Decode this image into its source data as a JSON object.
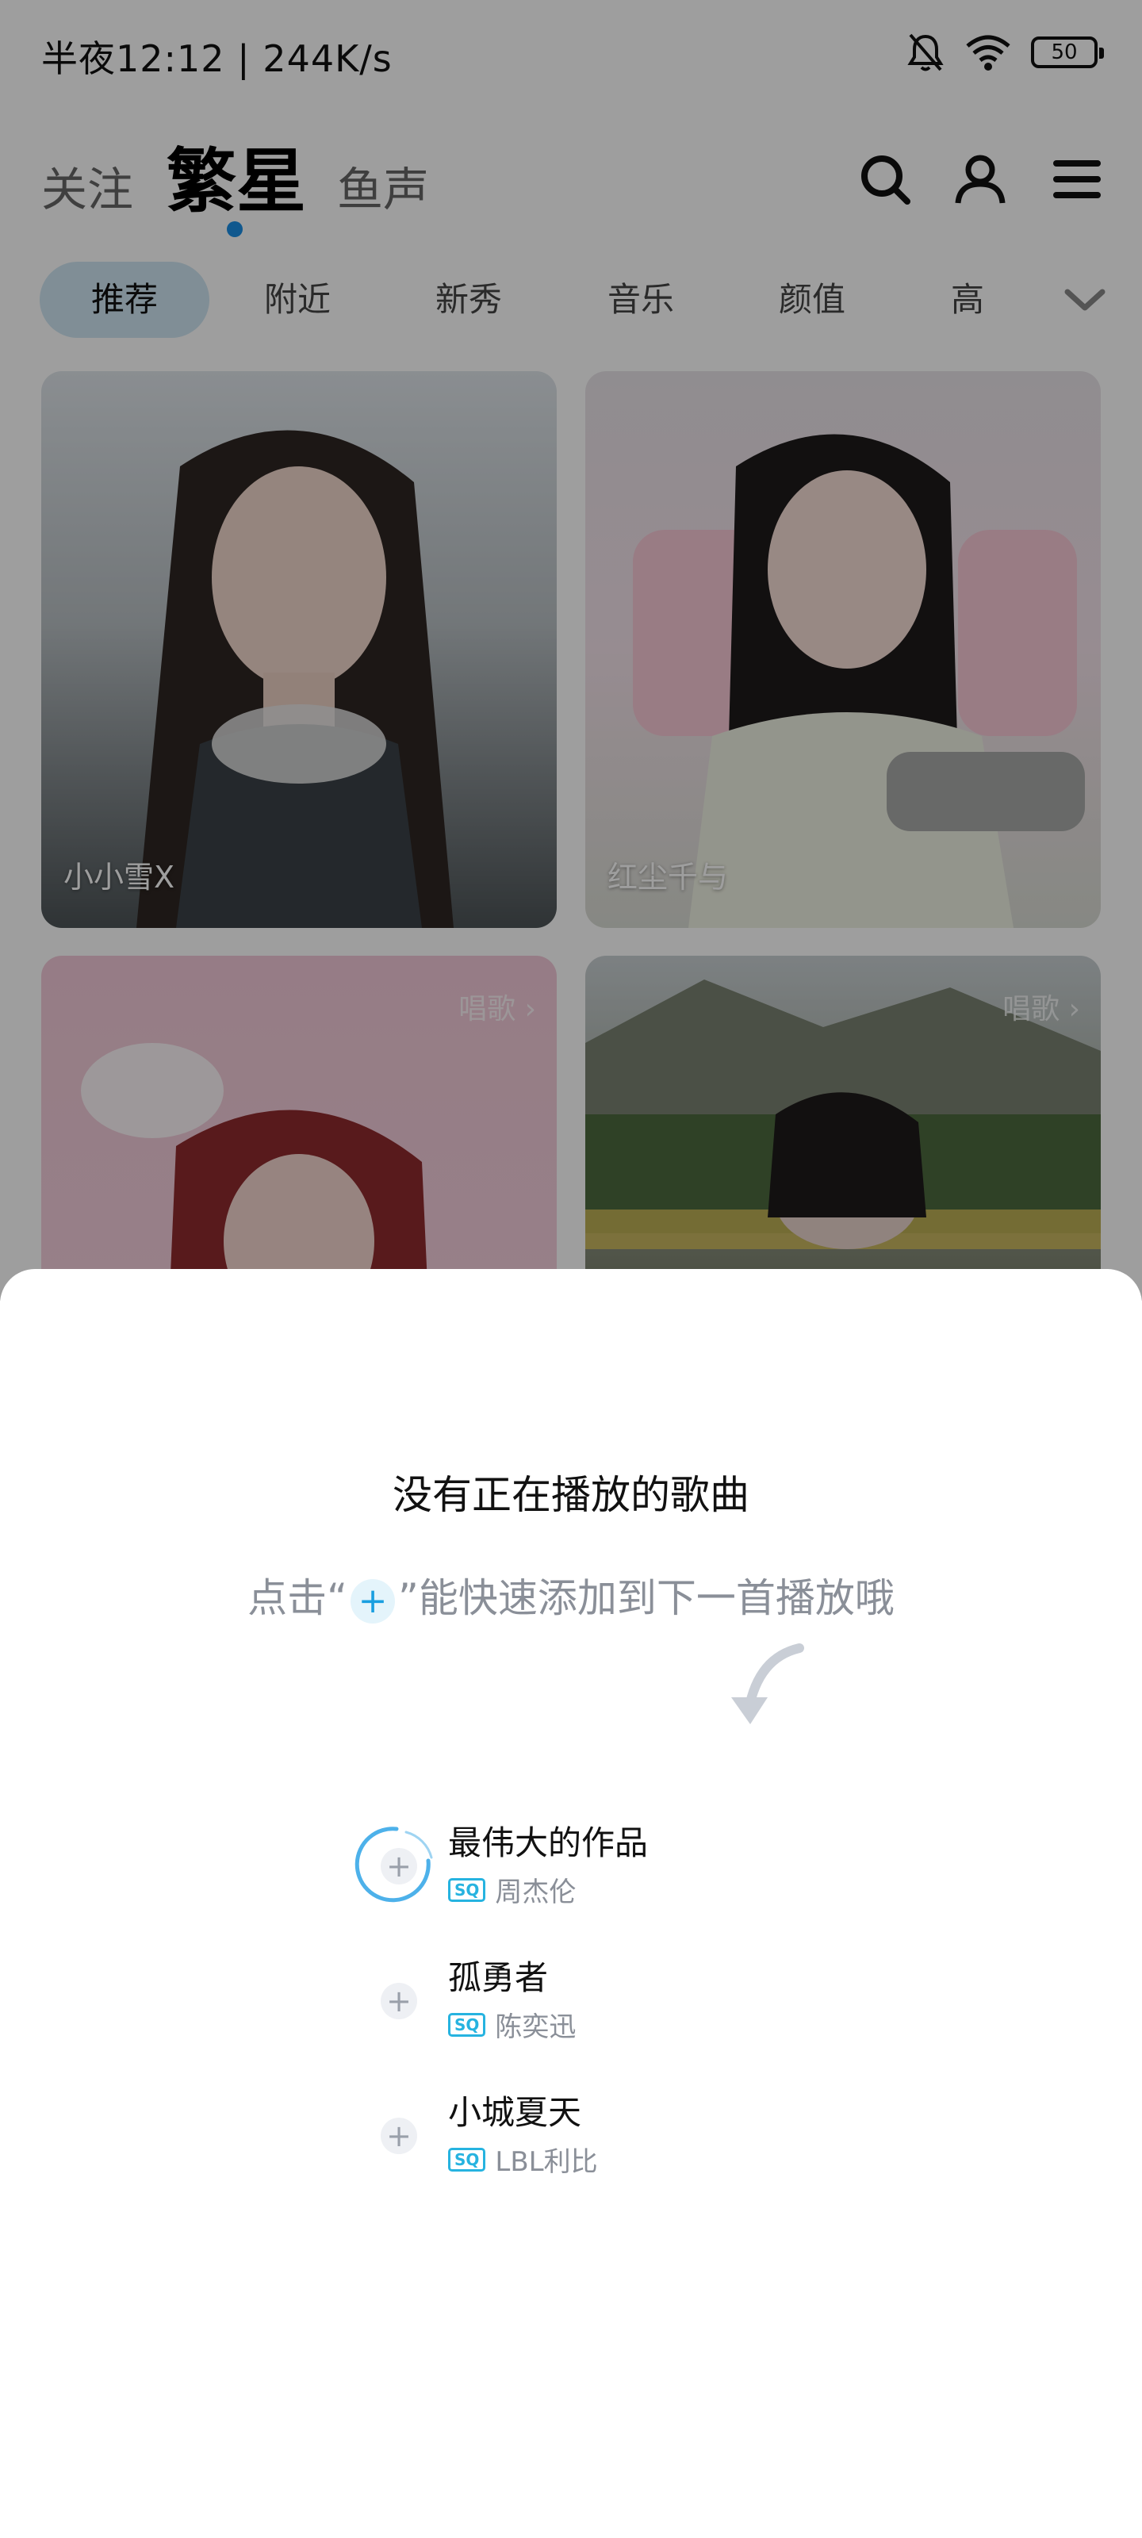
{
  "status_bar": {
    "time": "半夜12:12 | 244K/s",
    "battery": "50"
  },
  "header": {
    "tabs": [
      {
        "label": "关注"
      },
      {
        "label": "繁星"
      },
      {
        "label": "鱼声"
      }
    ],
    "active_tab": "繁星",
    "icons": [
      "search-icon",
      "profile-icon",
      "menu-icon"
    ],
    "accent_color": "#1a8fe6"
  },
  "categories": {
    "items": [
      {
        "label": "推荐"
      },
      {
        "label": "附近"
      },
      {
        "label": "新秀"
      },
      {
        "label": "音乐"
      },
      {
        "label": "颜值"
      },
      {
        "label": "高"
      }
    ],
    "active": "推荐"
  },
  "feed": {
    "cards": [
      {
        "name": "小小雪X",
        "tag": ""
      },
      {
        "name": "红尘千与",
        "tag": ""
      },
      {
        "name": "",
        "tag": "唱歌 ›"
      },
      {
        "name": "",
        "tag": "唱歌 ›"
      }
    ]
  },
  "sheet": {
    "title": "没有正在播放的歌曲",
    "hint_before": "点击“",
    "hint_plus": "+",
    "hint_after": "”能快速添加到下一首播放哦",
    "songs": [
      {
        "title": "最伟大的作品",
        "badge": "SQ",
        "artist": "周杰伦"
      },
      {
        "title": "孤勇者",
        "badge": "SQ",
        "artist": "陈奕迅"
      },
      {
        "title": "小城夏天",
        "badge": "SQ",
        "artist": "LBL利比"
      }
    ],
    "badge_color": "#26b3e0"
  }
}
